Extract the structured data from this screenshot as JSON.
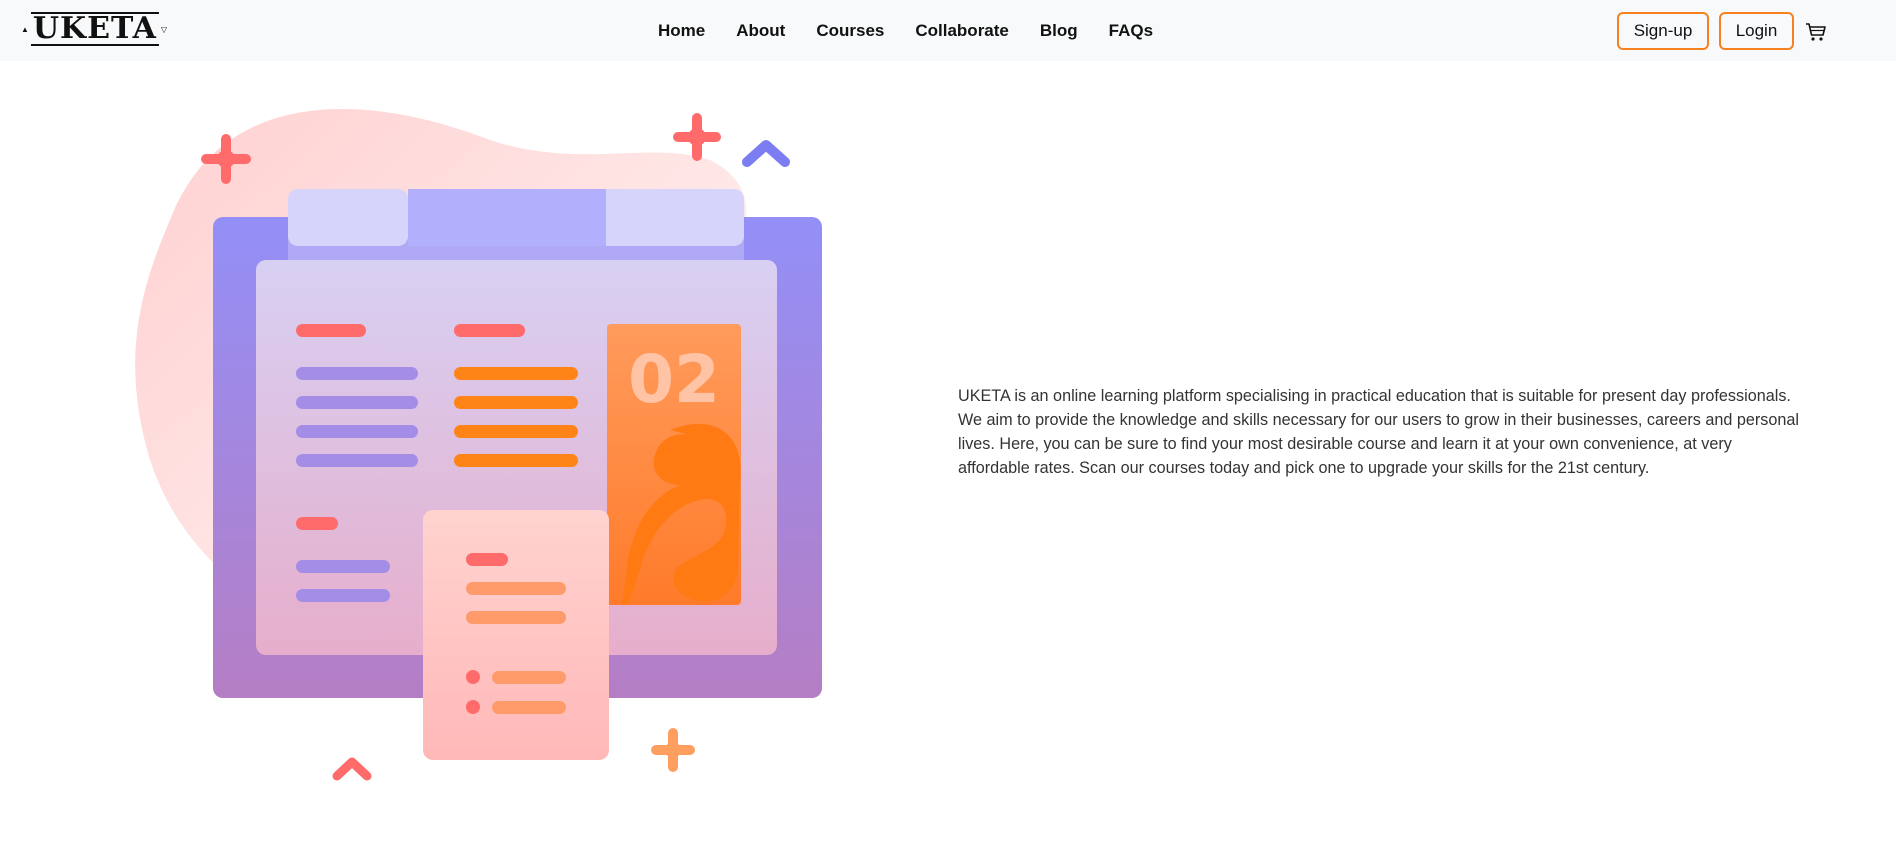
{
  "brand": {
    "logo_text": "UKETA"
  },
  "nav": {
    "links": [
      {
        "label": "Home"
      },
      {
        "label": "About"
      },
      {
        "label": "Courses"
      },
      {
        "label": "Collaborate"
      },
      {
        "label": "Blog"
      },
      {
        "label": "FAQs"
      }
    ],
    "signup_label": "Sign-up",
    "login_label": "Login",
    "cart_icon": "cart-icon"
  },
  "illustration": {
    "badge_text": "02"
  },
  "about": {
    "paragraph": "UKETA is an online learning platform specialising in practical education that is suitable for present day professionals. We aim to provide the knowledge and skills necessary for our users to grow in their businesses, careers and personal lives. Here, you can be sure to find your most desirable course and learn it at your own convenience, at very affordable rates. Scan our courses today and pick one to upgrade your skills for the 21st century."
  },
  "colors": {
    "accent_orange": "#f5821f",
    "nav_bg": "#f8f9fa",
    "illustration_purple": "#9b93f5",
    "illustration_pink": "#ffb3b3"
  }
}
